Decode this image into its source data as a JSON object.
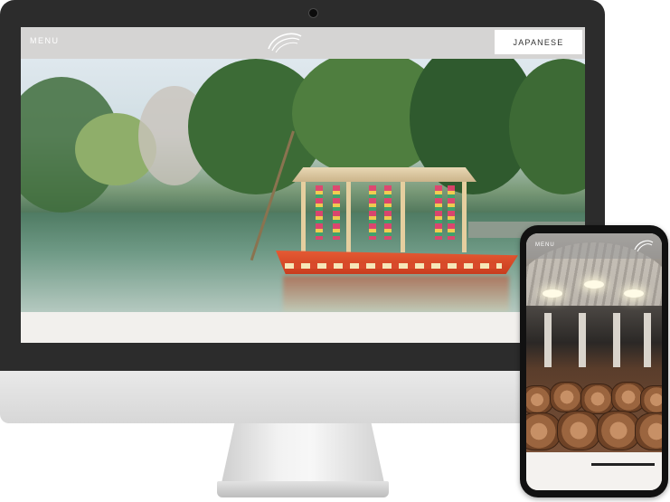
{
  "desktop": {
    "header": {
      "menu_label": "MENU",
      "language_button_label": "JAPANESE",
      "logo_icon": "brand-logo-icon"
    },
    "hero_image": "river-boat-photo"
  },
  "mobile": {
    "header": {
      "menu_label": "MENU",
      "logo_icon": "brand-logo-icon"
    },
    "hero_image": "barrel-cellar-photo"
  },
  "colors": {
    "device_bezel": "#2c2c2c",
    "header_overlay": "#bebebe",
    "page_background": "#f2f0ed",
    "boat_red": "#d94a2b"
  }
}
